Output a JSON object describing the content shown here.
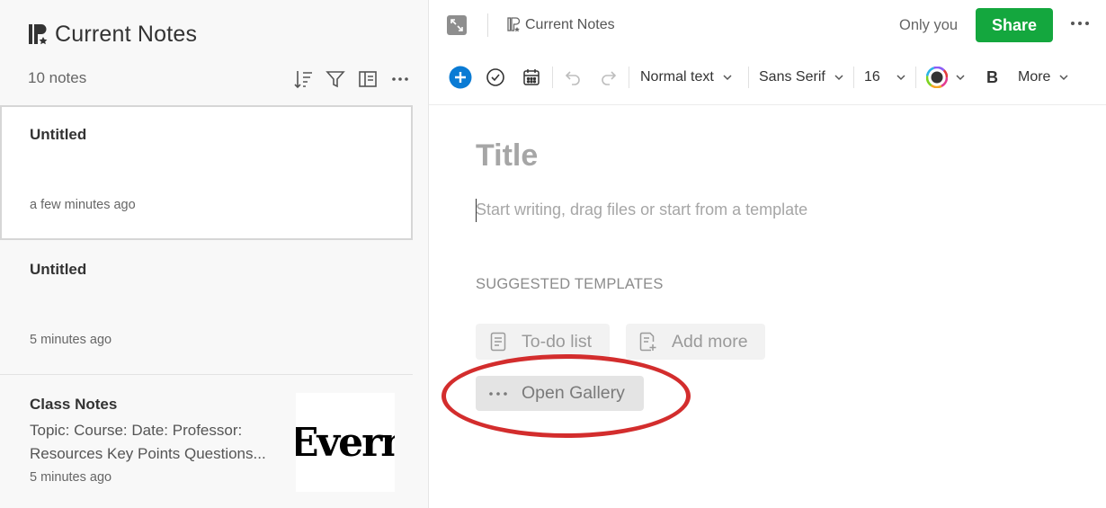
{
  "note_list": {
    "title": "Current Notes",
    "count": "10 notes",
    "icons": {
      "notebook": "notebook-icon",
      "sort": "sort-icon",
      "filter": "filter-icon",
      "view": "view-options-icon",
      "more": "more-icon"
    },
    "notes": [
      {
        "title": "Untitled",
        "time": "a few minutes ago",
        "selected": true
      },
      {
        "title": "Untitled",
        "time": "5 minutes ago"
      },
      {
        "title": "Class Notes",
        "snippet_lines": [
          "Topic: Course: Date: Professor:",
          "Resources Key Points Questions..."
        ],
        "time": "5 minutes ago",
        "thumbnail_text": "Evern"
      }
    ]
  },
  "editor": {
    "breadcrumb": "Current Notes",
    "sharing": "Only you",
    "share_label": "Share",
    "toolbar": {
      "text_style": "Normal text",
      "font": "Sans Serif",
      "font_size": "16",
      "bold": "B",
      "more": "More"
    },
    "title_placeholder": "Title",
    "body_placeholder": "Start writing, drag files or start from a template",
    "suggested_heading": "SUGGESTED TEMPLATES",
    "templates": [
      {
        "label": "To-do list",
        "icon": "document-icon"
      },
      {
        "label": "Add more",
        "icon": "add-template-icon"
      }
    ],
    "gallery_label": "Open Gallery"
  },
  "colors": {
    "share_green": "#14a73e",
    "insert_blue": "#0a7bd4",
    "annotation_red": "#d32d2d",
    "placeholder_gray": "#a6a6a6"
  }
}
